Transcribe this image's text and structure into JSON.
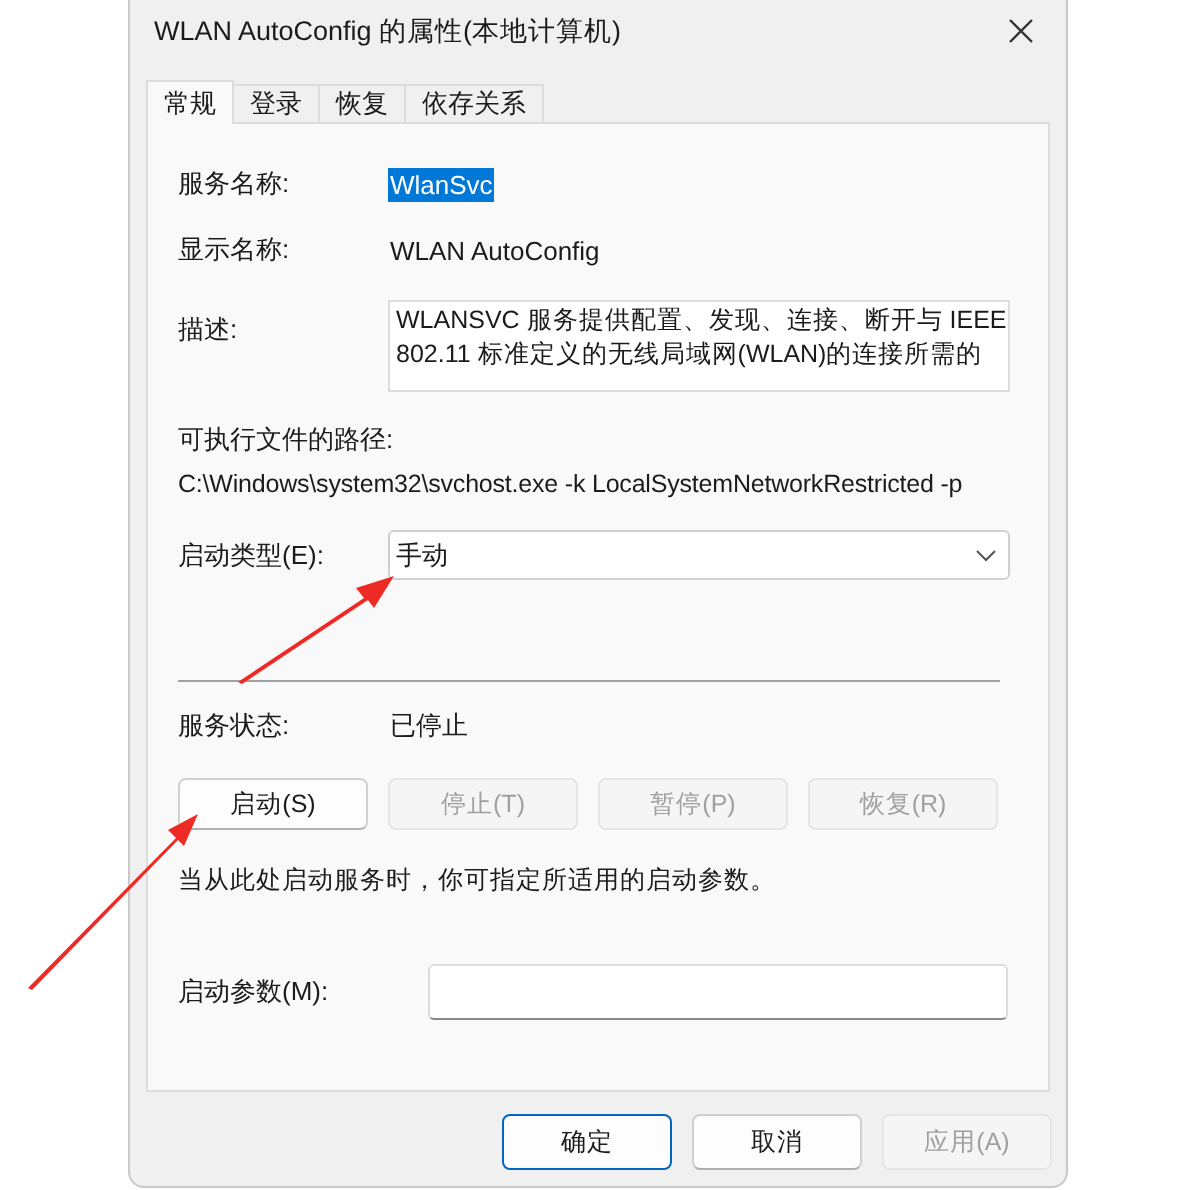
{
  "window": {
    "title": "WLAN AutoConfig 的属性(本地计算机)"
  },
  "tabs": [
    {
      "label": "常规",
      "selected": true
    },
    {
      "label": "登录",
      "selected": false
    },
    {
      "label": "恢复",
      "selected": false
    },
    {
      "label": "依存关系",
      "selected": false
    }
  ],
  "service_name": {
    "label": "服务名称:",
    "value": "WlanSvc",
    "selected": true
  },
  "display_name": {
    "label": "显示名称:",
    "value": "WLAN AutoConfig"
  },
  "description": {
    "label": "描述:",
    "lines": [
      "WLANSVC 服务提供配置、发现、连接、断开与 IEEE",
      "802.11 标准定义的无线局域网(WLAN)的连接所需的"
    ]
  },
  "executable_path": {
    "label": "可执行文件的路径:",
    "value": "C:\\Windows\\system32\\svchost.exe -k LocalSystemNetworkRestricted -p"
  },
  "startup_type": {
    "label": "启动类型(E):",
    "value": "手动"
  },
  "service_status": {
    "label": "服务状态:",
    "value": "已停止"
  },
  "control_buttons": [
    {
      "label": "启动(S)",
      "disabled": false
    },
    {
      "label": "停止(T)",
      "disabled": true
    },
    {
      "label": "暂停(P)",
      "disabled": true
    },
    {
      "label": "恢复(R)",
      "disabled": true
    }
  ],
  "hint": "当从此处启动服务时，你可指定所适用的启动参数。",
  "start_parameters": {
    "label": "启动参数(M):"
  },
  "dialog_buttons": [
    {
      "label": "确定",
      "default": true,
      "disabled": false
    },
    {
      "label": "取消",
      "default": false,
      "disabled": false
    },
    {
      "label": "应用(A)",
      "default": false,
      "disabled": true
    }
  ]
}
